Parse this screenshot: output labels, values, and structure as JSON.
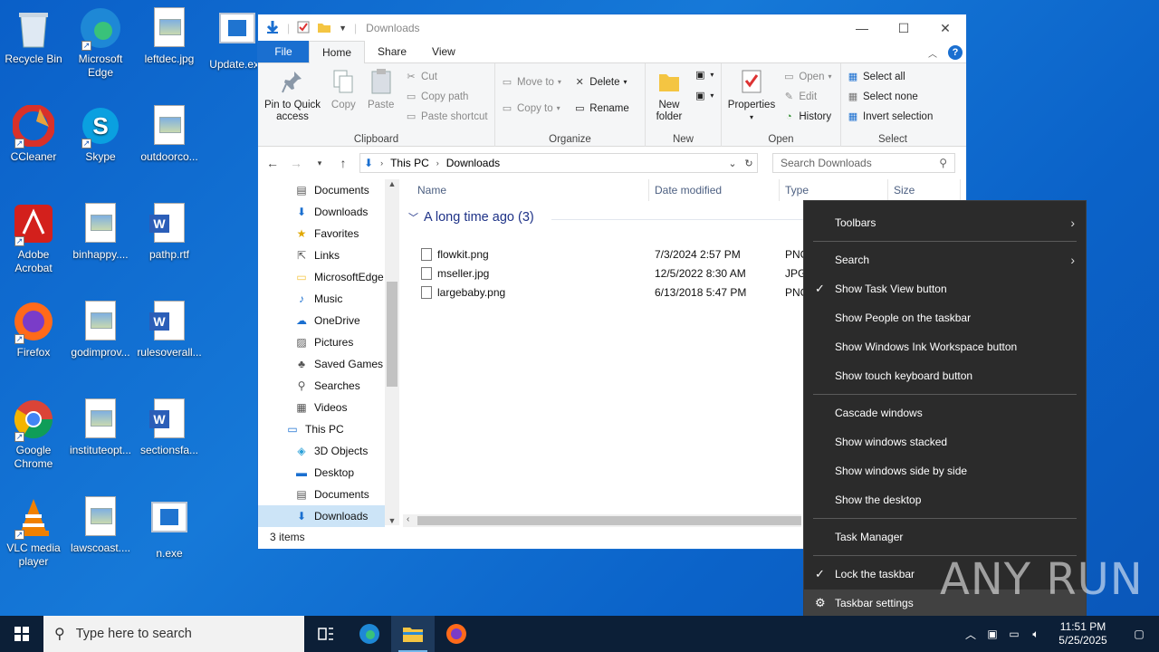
{
  "desktop": {
    "icons": [
      {
        "label": "Recycle Bin",
        "icon": "recycle-bin-icon"
      },
      {
        "label": "Microsoft Edge",
        "icon": "edge-icon"
      },
      {
        "label": "leftdec.jpg",
        "icon": "image-file-icon"
      },
      {
        "label": "Update.exe",
        "icon": "exe-file-icon"
      },
      {
        "label": "CCleaner",
        "icon": "ccleaner-icon"
      },
      {
        "label": "Skype",
        "icon": "skype-icon"
      },
      {
        "label": "outdoorco...",
        "icon": "image-file-icon"
      },
      {
        "label": "Adobe Acrobat",
        "icon": "acrobat-icon"
      },
      {
        "label": "binhappy....",
        "icon": "image-file-icon"
      },
      {
        "label": "pathp.rtf",
        "icon": "word-file-icon"
      },
      {
        "label": "Firefox",
        "icon": "firefox-icon"
      },
      {
        "label": "godimprov...",
        "icon": "image-file-icon"
      },
      {
        "label": "rulesoverall...",
        "icon": "word-file-icon"
      },
      {
        "label": "Google Chrome",
        "icon": "chrome-icon"
      },
      {
        "label": "instituteopt...",
        "icon": "image-file-icon"
      },
      {
        "label": "sectionsfa...",
        "icon": "word-file-icon"
      },
      {
        "label": "VLC media player",
        "icon": "vlc-icon"
      },
      {
        "label": "lawscoast....",
        "icon": "image-file-icon"
      },
      {
        "label": "n.exe",
        "icon": "exe-file-icon"
      }
    ]
  },
  "explorer": {
    "title": "Downloads",
    "tabs": [
      "File",
      "Home",
      "Share",
      "View"
    ],
    "active_tab": "Home",
    "ribbon": {
      "clipboard": {
        "label": "Clipboard",
        "pin": "Pin to Quick access",
        "copy": "Copy",
        "paste": "Paste",
        "cut": "Cut",
        "copy_path": "Copy path",
        "paste_shortcut": "Paste shortcut"
      },
      "organize": {
        "label": "Organize",
        "move_to": "Move to",
        "copy_to": "Copy to",
        "delete": "Delete",
        "rename": "Rename"
      },
      "new": {
        "label": "New",
        "new_folder": "New folder"
      },
      "open": {
        "label": "Open",
        "properties": "Properties",
        "open": "Open",
        "edit": "Edit",
        "history": "History"
      },
      "select": {
        "label": "Select",
        "select_all": "Select all",
        "select_none": "Select none",
        "invert": "Invert selection"
      }
    },
    "address": {
      "crumbs": [
        "This PC",
        "Downloads"
      ],
      "search_placeholder": "Search Downloads"
    },
    "nav": [
      {
        "label": "Documents",
        "icon": "documents-icon",
        "indent": 1
      },
      {
        "label": "Downloads",
        "icon": "downloads-icon",
        "indent": 1
      },
      {
        "label": "Favorites",
        "icon": "favorites-icon",
        "indent": 1
      },
      {
        "label": "Links",
        "icon": "links-icon",
        "indent": 1
      },
      {
        "label": "MicrosoftEdge",
        "icon": "folder-icon",
        "indent": 1
      },
      {
        "label": "Music",
        "icon": "music-icon",
        "indent": 1
      },
      {
        "label": "OneDrive",
        "icon": "onedrive-icon",
        "indent": 1
      },
      {
        "label": "Pictures",
        "icon": "pictures-icon",
        "indent": 1
      },
      {
        "label": "Saved Games",
        "icon": "saved-games-icon",
        "indent": 1
      },
      {
        "label": "Searches",
        "icon": "searches-icon",
        "indent": 1
      },
      {
        "label": "Videos",
        "icon": "videos-icon",
        "indent": 1
      },
      {
        "label": "This PC",
        "icon": "this-pc-icon",
        "indent": 0
      },
      {
        "label": "3D Objects",
        "icon": "3d-objects-icon",
        "indent": 1
      },
      {
        "label": "Desktop",
        "icon": "desktop-icon",
        "indent": 1
      },
      {
        "label": "Documents",
        "icon": "documents-icon",
        "indent": 1
      },
      {
        "label": "Downloads",
        "icon": "downloads-icon",
        "indent": 1,
        "selected": true
      }
    ],
    "columns": [
      "Name",
      "Date modified",
      "Type",
      "Size"
    ],
    "group": "A long time ago (3)",
    "files": [
      {
        "name": "flowkit.png",
        "date": "7/3/2024 2:57 PM",
        "type": "PNG"
      },
      {
        "name": "mseller.jpg",
        "date": "12/5/2022 8:30 AM",
        "type": "JPG"
      },
      {
        "name": "largebaby.png",
        "date": "6/13/2018 5:47 PM",
        "type": "PNG"
      }
    ],
    "status": "3 items"
  },
  "context_menu": {
    "items": [
      {
        "label": "Toolbars",
        "submenu": true
      },
      {
        "label": "Search",
        "submenu": true
      },
      {
        "label": "Show Task View button",
        "checked": true
      },
      {
        "label": "Show People on the taskbar"
      },
      {
        "label": "Show Windows Ink Workspace button"
      },
      {
        "label": "Show touch keyboard button"
      },
      {
        "label": "Cascade windows"
      },
      {
        "label": "Show windows stacked"
      },
      {
        "label": "Show windows side by side"
      },
      {
        "label": "Show the desktop"
      },
      {
        "label": "Task Manager"
      },
      {
        "label": "Lock the taskbar",
        "checked": true
      },
      {
        "label": "Taskbar settings",
        "icon": "gear-icon"
      }
    ]
  },
  "taskbar": {
    "search_placeholder": "Type here to search",
    "time": "11:51 PM",
    "date": "5/25/2025"
  },
  "watermark": "ANY RUN",
  "colors": {
    "accent": "#1a6fd0",
    "menu_bg": "#2b2b2b",
    "taskbar_bg": "#0c1f37"
  }
}
